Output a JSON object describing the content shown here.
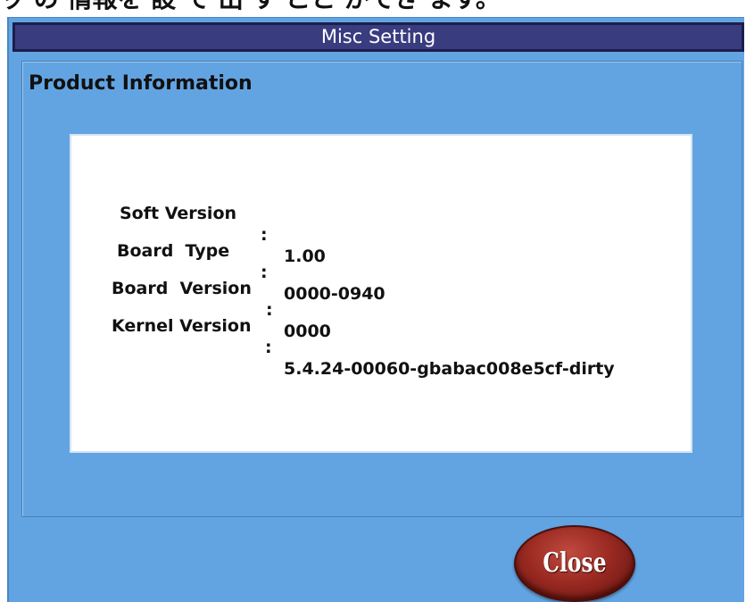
{
  "top_text": "ッ の 情報を 設 で 出 す こと ができ ます。",
  "window": {
    "title": "Misc Setting"
  },
  "product_information": {
    "heading": "Product Information",
    "rows": [
      {
        "label": "Soft Version",
        "separator": ":",
        "value": "1.00"
      },
      {
        "label": "Board  Type",
        "separator": ":",
        "value": "0000-0940"
      },
      {
        "label": "Board  Version",
        "separator": ":",
        "value": "0000"
      },
      {
        "label": "Kernel Version",
        "separator": ":",
        "value": "5.4.24-00060-gbabac008e5cf-dirty"
      }
    ]
  },
  "buttons": {
    "close_label": "Close"
  }
}
